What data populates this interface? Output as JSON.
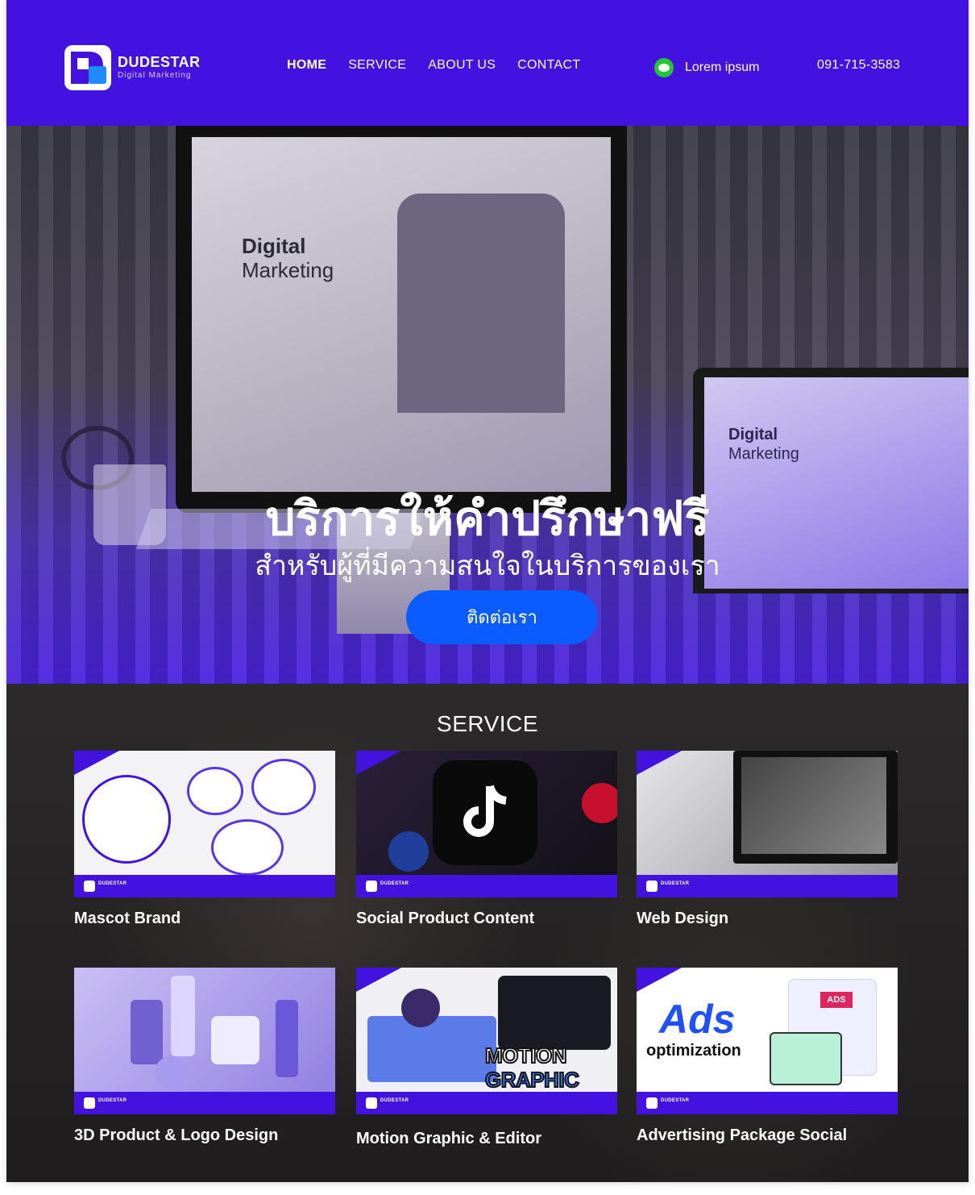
{
  "header": {
    "logo_name": "DUDESTAR",
    "logo_sub": "Digital Marketing",
    "nav": [
      "HOME",
      "SERVICE",
      "ABOUT US",
      "CONTACT"
    ],
    "line_label": "Lorem ipsum",
    "phone": "091-715-3583",
    "colors": {
      "brand": "#4311e0",
      "line": "#22c934"
    }
  },
  "hero": {
    "title": "บริการให้คำปรึกษาฟรี",
    "subtitle": "สำหรับผู้ที่มีความสนใจในบริการของเรา",
    "cta_label": "ติดต่อเรา",
    "cta_color": "#0a5cff",
    "monitor_title_1": "Digital",
    "monitor_title_2": "Marketing",
    "laptop_title_1": "Digital",
    "laptop_title_2": "Marketing"
  },
  "services": {
    "title": "SERVICE",
    "mini_logo_text": "DUDESTAR",
    "items": [
      {
        "label": "Mascot Brand"
      },
      {
        "label": "Social Product Content"
      },
      {
        "label": "Web Design"
      },
      {
        "label": "3D Product & Logo Design"
      },
      {
        "label": "Motion  Graphic & Editor"
      },
      {
        "label": "Advertising Package Social"
      }
    ],
    "thumb_texts": {
      "motion_1": "MOTION",
      "motion_2": "GRAPHIC",
      "ads_1": "Ads",
      "ads_2": "optimization",
      "ads_badge": "ADS"
    }
  }
}
